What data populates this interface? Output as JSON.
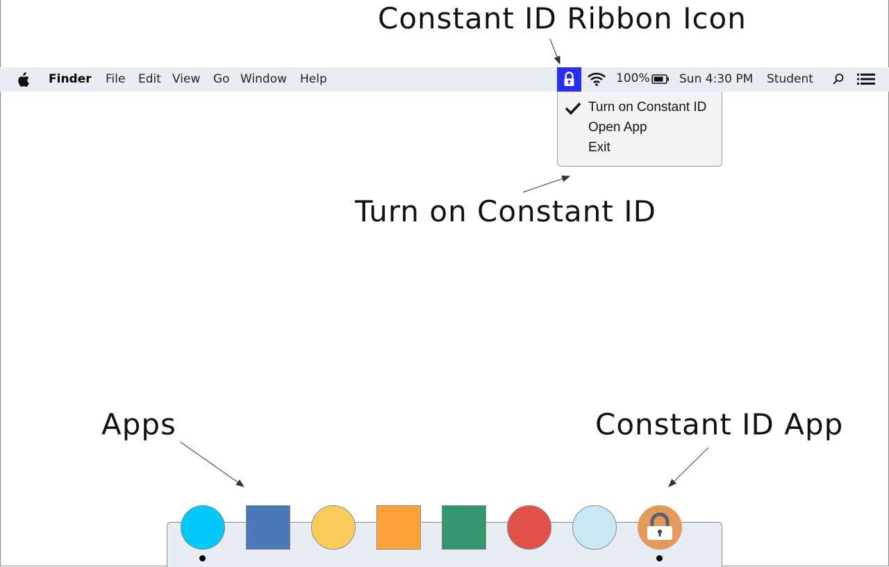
{
  "annotations": {
    "ribbon_icon": "Constant ID Ribbon Icon",
    "turn_on": "Turn on Constant ID",
    "apps": "Apps",
    "constant_id_app": "Constant ID App"
  },
  "menubar": {
    "app_name": "Finder",
    "menus": [
      "File",
      "Edit",
      "View",
      "Go",
      "Window",
      "Help"
    ],
    "battery": "100%",
    "clock": "Sun 4:30 PM",
    "user": "Student",
    "icons": [
      "apple-icon",
      "lock-icon",
      "wifi-icon",
      "battery-icon",
      "search-icon",
      "list-icon"
    ]
  },
  "dropdown": {
    "items": [
      "Turn on Constant ID",
      "Open App",
      "Exit"
    ],
    "checked_item": "Turn on Constant ID"
  },
  "dock": {
    "apps": [
      {
        "shape": "circle",
        "color": "#00c8f8",
        "running": true
      },
      {
        "shape": "square",
        "color": "#4a78b8",
        "running": false
      },
      {
        "shape": "circle",
        "color": "#fbcc5c",
        "running": false
      },
      {
        "shape": "square",
        "color": "#fca136",
        "running": false
      },
      {
        "shape": "square",
        "color": "#33966c",
        "running": false
      },
      {
        "shape": "circle",
        "color": "#e2504a",
        "running": false
      },
      {
        "shape": "circle",
        "color": "#c8e8f4",
        "running": false
      },
      {
        "shape": "circle",
        "color": "#e39a5c",
        "running": true,
        "icon": "lock-icon"
      }
    ]
  },
  "colors": {
    "ribbon_icon_bg": "#2a2df0",
    "menubar_bg": "#e8edf4"
  }
}
